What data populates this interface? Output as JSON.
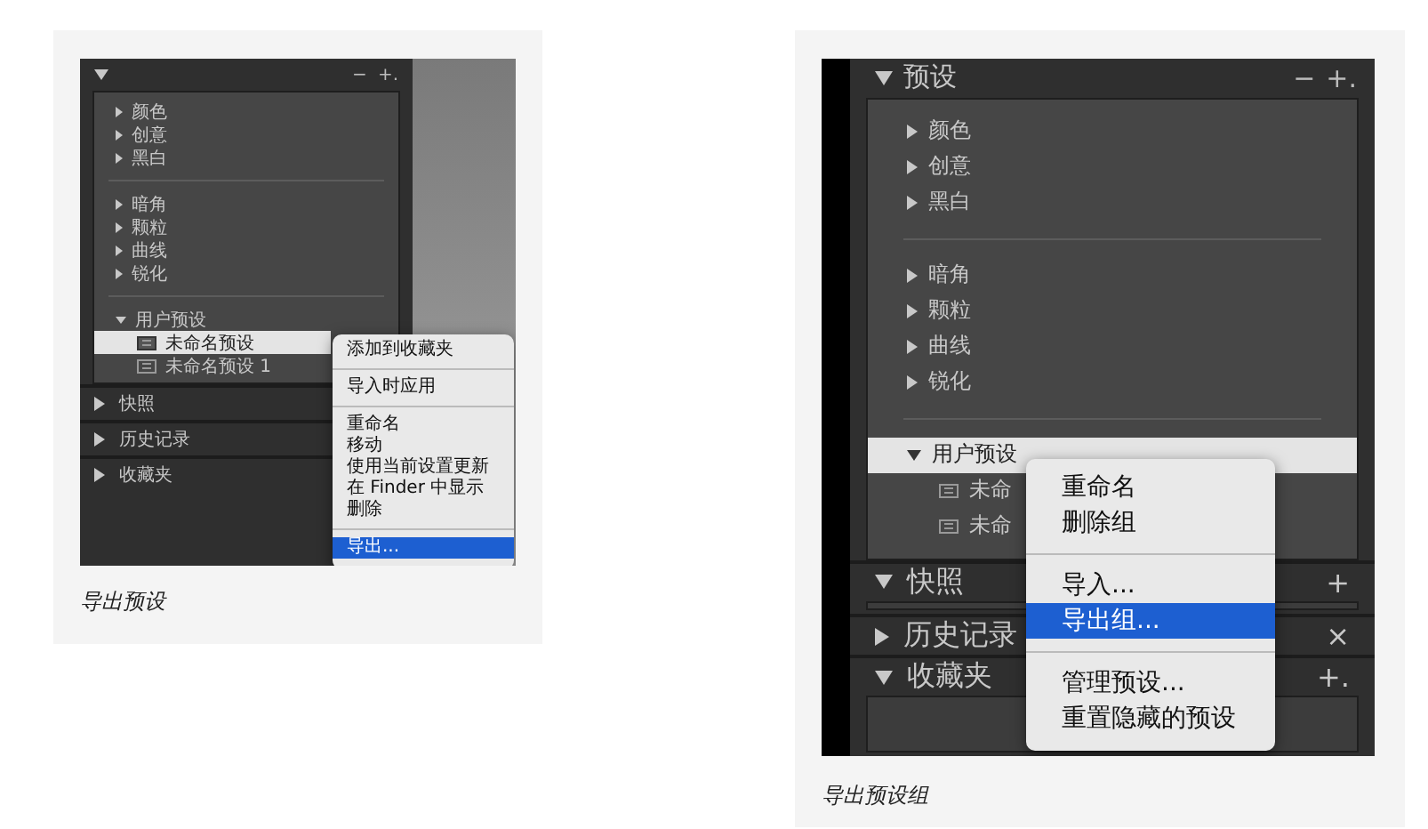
{
  "figures": [
    {
      "caption": "导出预设",
      "panel": {
        "header": {
          "expanded": true,
          "actions": [
            "−",
            "+."
          ]
        },
        "groups": [
          [
            {
              "label": "颜色",
              "expanded": false
            },
            {
              "label": "创意",
              "expanded": false
            },
            {
              "label": "黑白",
              "expanded": false
            }
          ],
          [
            {
              "label": "暗角",
              "expanded": false
            },
            {
              "label": "颗粒",
              "expanded": false
            },
            {
              "label": "曲线",
              "expanded": false
            },
            {
              "label": "锐化",
              "expanded": false
            }
          ]
        ],
        "user_group": {
          "label": "用户预设",
          "expanded": true,
          "selected": false,
          "children": [
            {
              "label": "未命名预设",
              "selected": true
            },
            {
              "label": "未命名预设 1",
              "selected": false
            }
          ]
        },
        "sections": [
          {
            "label": "快照",
            "expanded": false
          },
          {
            "label": "历史记录",
            "expanded": false
          },
          {
            "label": "收藏夹",
            "expanded": false
          }
        ]
      },
      "menu": {
        "groups": [
          [
            {
              "label": "添加到收藏夹",
              "selected": false
            }
          ],
          [
            {
              "label": "导入时应用",
              "selected": false
            }
          ],
          [
            {
              "label": "重命名",
              "selected": false
            },
            {
              "label": "移动",
              "selected": false
            },
            {
              "label": "使用当前设置更新",
              "selected": false
            },
            {
              "label": "在 Finder 中显示",
              "selected": false
            },
            {
              "label": "删除",
              "selected": false
            }
          ],
          [
            {
              "label": "导出...",
              "selected": true
            }
          ]
        ]
      }
    },
    {
      "caption": "导出预设组",
      "panel": {
        "header": {
          "title": "预设",
          "expanded": true,
          "actions": [
            "−",
            "+."
          ]
        },
        "groups": [
          [
            {
              "label": "颜色",
              "expanded": false
            },
            {
              "label": "创意",
              "expanded": false
            },
            {
              "label": "黑白",
              "expanded": false
            }
          ],
          [
            {
              "label": "暗角",
              "expanded": false
            },
            {
              "label": "颗粒",
              "expanded": false
            },
            {
              "label": "曲线",
              "expanded": false
            },
            {
              "label": "锐化",
              "expanded": false
            }
          ]
        ],
        "user_group": {
          "label": "用户预设",
          "expanded": true,
          "selected": true,
          "children": [
            {
              "label": "未命",
              "selected": false
            },
            {
              "label": "未命",
              "selected": false
            }
          ]
        },
        "sections": [
          {
            "label": "快照",
            "expanded": true,
            "action": "+"
          },
          {
            "label": "历史记录",
            "expanded": false,
            "action": "×"
          },
          {
            "label": "收藏夹",
            "expanded": true,
            "action": "+."
          }
        ]
      },
      "menu": {
        "groups": [
          [
            {
              "label": "重命名",
              "selected": false
            },
            {
              "label": "删除组",
              "selected": false
            }
          ],
          [
            {
              "label": "导入...",
              "selected": false
            },
            {
              "label": "导出组...",
              "selected": true
            }
          ],
          [
            {
              "label": "管理预设...",
              "selected": false
            },
            {
              "label": "重置隐藏的预设",
              "selected": false
            }
          ]
        ]
      }
    }
  ]
}
